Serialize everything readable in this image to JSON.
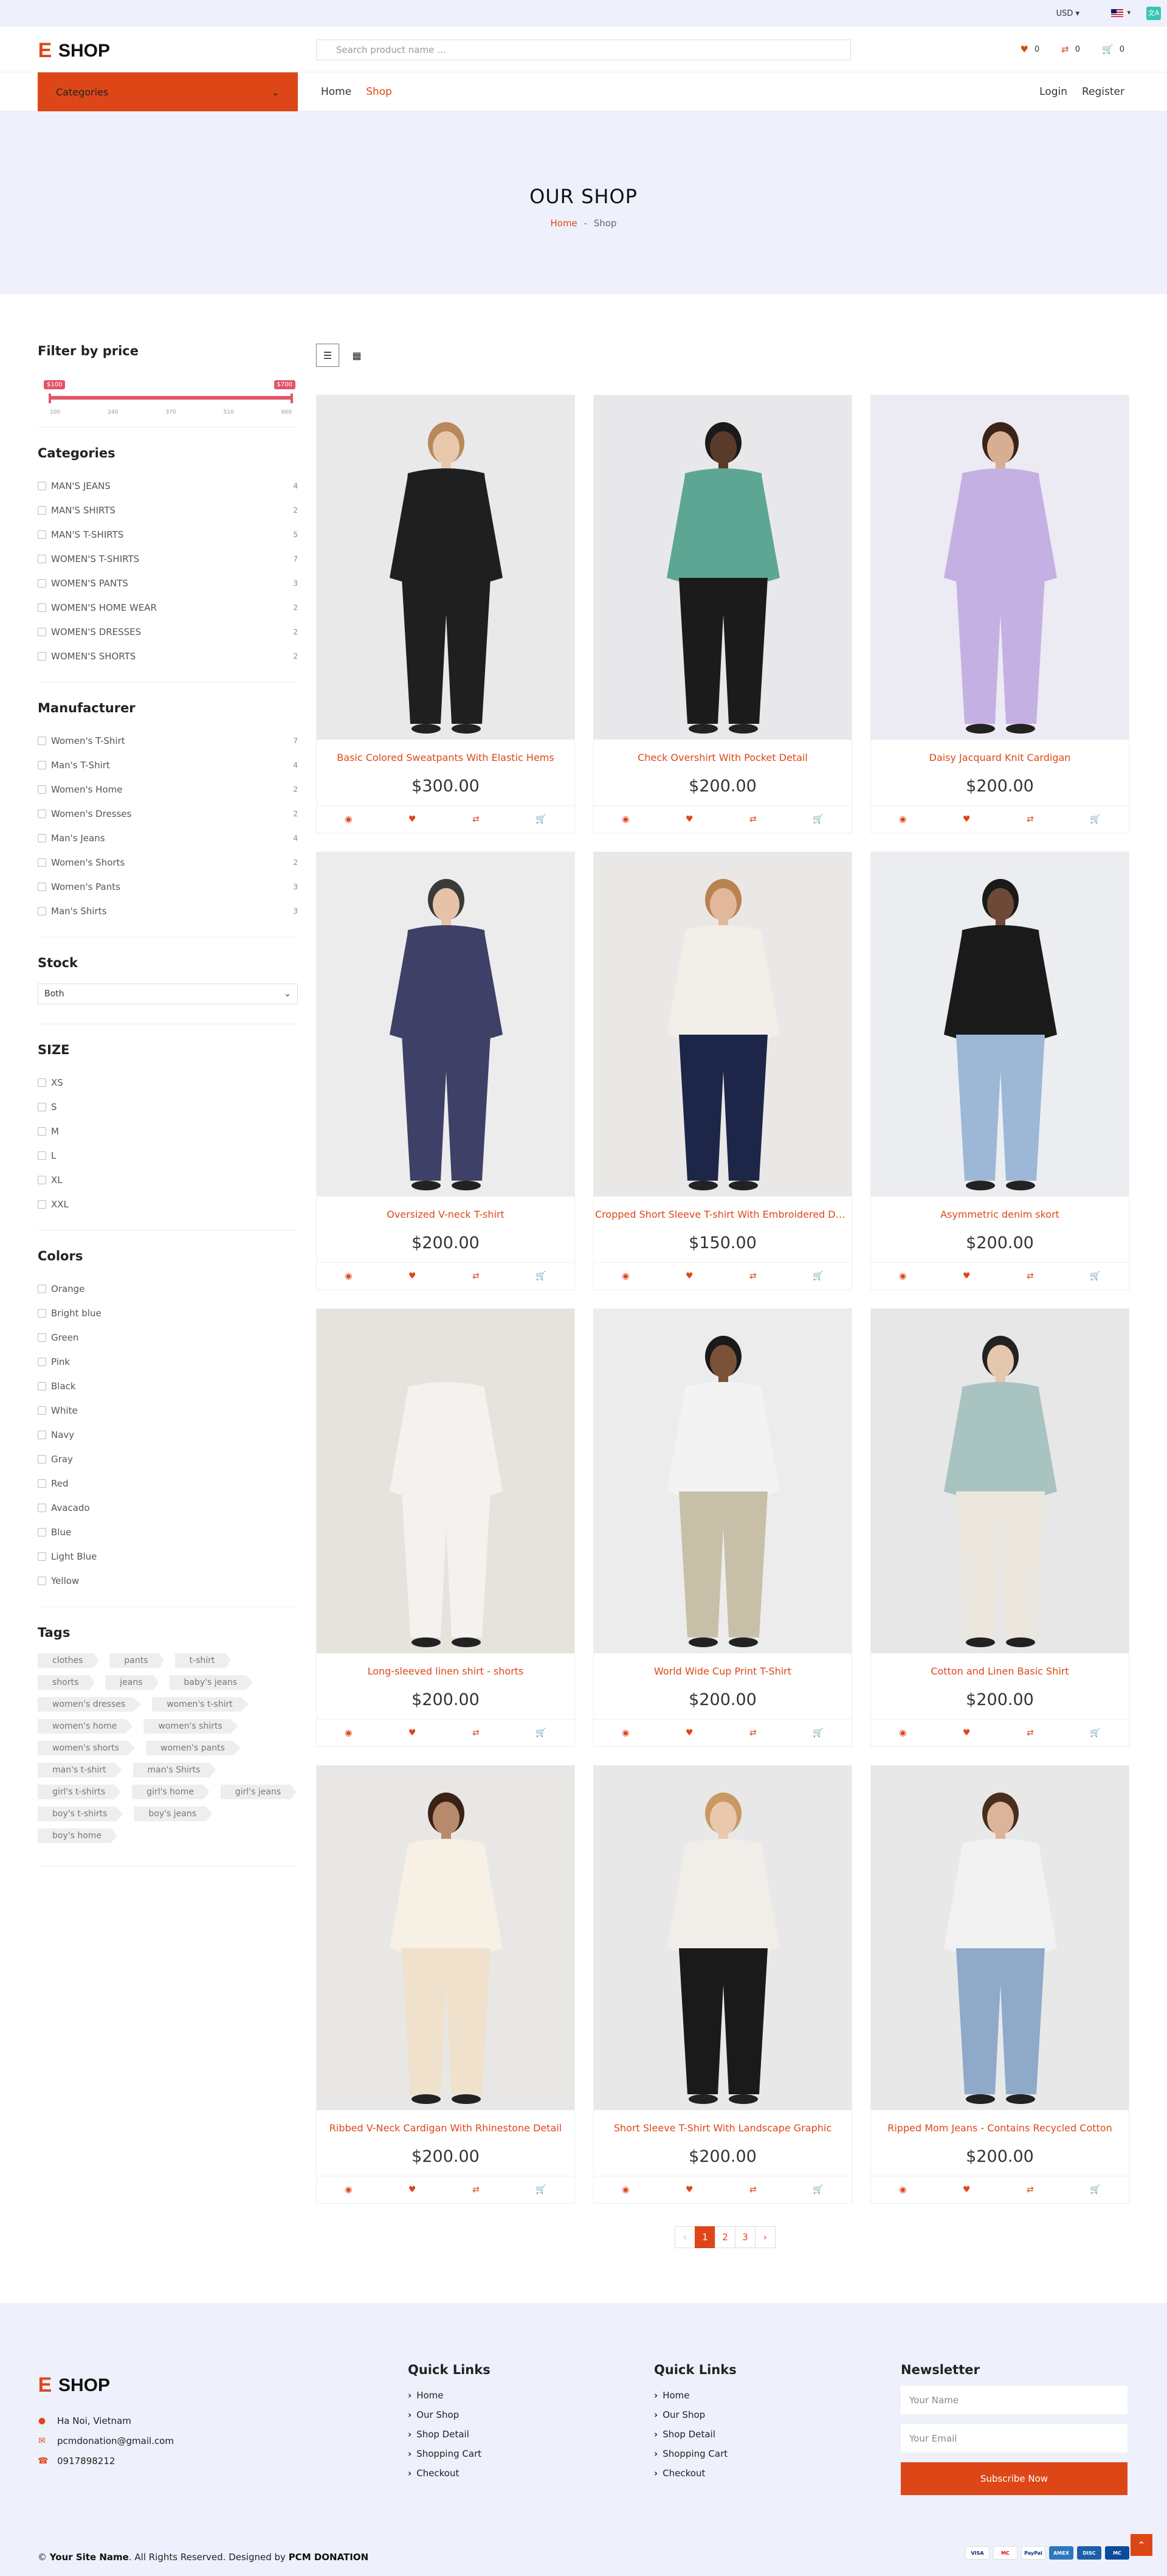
{
  "topbar": {
    "currency": "USD ▾",
    "flag_caret": "▾",
    "translate_icon": "文A"
  },
  "header": {
    "logo_letter": "E",
    "logo_text": "SHOP",
    "search_placeholder": "Search product name ...",
    "wishlist_count": "0",
    "compare_count": "0",
    "cart_count": "0"
  },
  "nav": {
    "categories_label": "Categories",
    "links": [
      "Home",
      "Shop"
    ],
    "login": "Login",
    "register": "Register"
  },
  "banner": {
    "title": "OUR SHOP",
    "crumb_home": "Home",
    "crumb_sep": "-",
    "crumb_current": "Shop"
  },
  "sidebar": {
    "price": {
      "title": "Filter by price",
      "min_label": "$100",
      "max_label": "$700",
      "ticks": [
        "100",
        "240",
        "370",
        "510",
        "660"
      ]
    },
    "categories": {
      "title": "Categories",
      "items": [
        {
          "label": "MAN'S JEANS",
          "count": "4"
        },
        {
          "label": "MAN'S SHIRTS",
          "count": "2"
        },
        {
          "label": "MAN'S T-SHIRTS",
          "count": "5"
        },
        {
          "label": "WOMEN'S T-SHIRTS",
          "count": "7"
        },
        {
          "label": "WOMEN'S PANTS",
          "count": "3"
        },
        {
          "label": "WOMEN'S HOME WEAR",
          "count": "2"
        },
        {
          "label": "WOMEN'S DRESSES",
          "count": "2"
        },
        {
          "label": "WOMEN'S SHORTS",
          "count": "2"
        }
      ]
    },
    "manufacturer": {
      "title": "Manufacturer",
      "items": [
        {
          "label": "Women's T-Shirt",
          "count": "7"
        },
        {
          "label": "Man's T-Shirt",
          "count": "4"
        },
        {
          "label": "Women's Home",
          "count": "2"
        },
        {
          "label": "Women's Dresses",
          "count": "2"
        },
        {
          "label": "Man's Jeans",
          "count": "4"
        },
        {
          "label": "Women's Shorts",
          "count": "2"
        },
        {
          "label": "Women's Pants",
          "count": "3"
        },
        {
          "label": "Man's Shirts",
          "count": "3"
        }
      ]
    },
    "stock": {
      "title": "Stock",
      "selected": "Both"
    },
    "size": {
      "title": "SIZE",
      "items": [
        "XS",
        "S",
        "M",
        "L",
        "XL",
        "XXL"
      ]
    },
    "colors": {
      "title": "Colors",
      "items": [
        "Orange",
        "Bright blue",
        "Green",
        "Pink",
        "Black",
        "White",
        "Navy",
        "Gray",
        "Red",
        "Avacado",
        "Blue",
        "Light Blue",
        "Yellow"
      ]
    },
    "tags": {
      "title": "Tags",
      "items": [
        "clothes",
        "pants",
        "t-shirt",
        "shorts",
        "jeans",
        "baby's jeans",
        "women's dresses",
        "women's t-shirt",
        "women's home",
        "women's shirts",
        "women's shorts",
        "women's pants",
        "man's t-shirt",
        "man's Shirts",
        "girl's t-shirts",
        "girl's home",
        "girl's jeans",
        "boy's t-shirts",
        "boy's jeans",
        "boy's home"
      ]
    }
  },
  "products": [
    {
      "name": "Basic Colored Sweatpants With Elastic Hems",
      "price": "$300.00"
    },
    {
      "name": "Check Overshirt With Pocket Detail",
      "price": "$200.00"
    },
    {
      "name": "Daisy Jacquard Knit Cardigan",
      "price": "$200.00"
    },
    {
      "name": "Oversized V-neck T-shirt",
      "price": "$200.00"
    },
    {
      "name": "Cropped Short Sleeve T-shirt With Embroidered Detail",
      "price": "$150.00"
    },
    {
      "name": "Asymmetric denim skort",
      "price": "$200.00"
    },
    {
      "name": "Long-sleeved linen shirt - shorts",
      "price": "$200.00"
    },
    {
      "name": "World Wide Cup Print T-Shirt",
      "price": "$200.00"
    },
    {
      "name": "Cotton and Linen Basic Shirt",
      "price": "$200.00"
    },
    {
      "name": "Ribbed V-Neck Cardigan With Rhinestone Detail",
      "price": "$200.00"
    },
    {
      "name": "Short Sleeve T-Shirt With Landscape Graphic",
      "price": "$200.00"
    },
    {
      "name": "Ripped Mom Jeans - Contains Recycled Cotton",
      "price": "$200.00"
    }
  ],
  "pagination": {
    "prev": "‹",
    "pages": [
      "1",
      "2",
      "3"
    ],
    "next": "›"
  },
  "footer": {
    "address": "Ha Noi, Vietnam",
    "email": "pcmdonation@gmail.com",
    "phone": "0917898212",
    "col1_title": "Quick Links",
    "col2_title": "Quick Links",
    "links": [
      "Home",
      "Our Shop",
      "Shop Detail",
      "Shopping Cart",
      "Checkout"
    ],
    "newsletter_title": "Newsletter",
    "name_placeholder": "Your Name",
    "email_placeholder": "Your Email",
    "subscribe": "Subscribe Now",
    "copy_prefix": "©",
    "site_name": "Your Site Name",
    "copy_mid": ". All Rights Reserved. Designed by",
    "designer": "PCM DONATION",
    "payments": [
      "VISA",
      "MC",
      "PayPal",
      "AMEX",
      "DISC",
      "MC"
    ]
  },
  "colors": {
    "accent": "#dd4718",
    "bg_light": "#eef0fb",
    "slider": "#e4546a"
  }
}
